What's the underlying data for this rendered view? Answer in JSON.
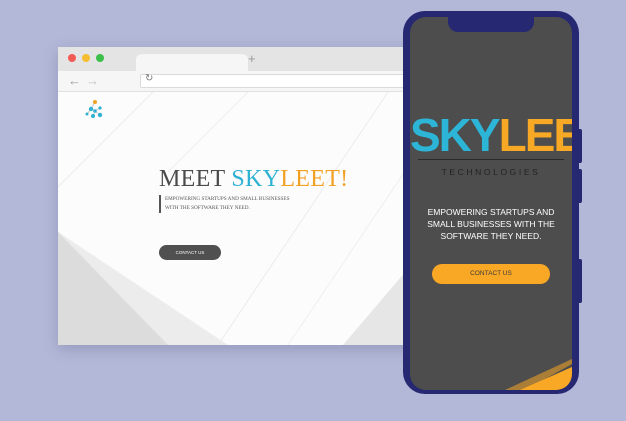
{
  "browser": {
    "new_tab_symbol": "+",
    "back_icon": "←",
    "forward_icon": "→",
    "reload_icon": "↻"
  },
  "desktop": {
    "logo_icon": "skyleet-molecule-logo",
    "title_prefix": "MEET ",
    "title_sky": "SKY",
    "title_leet": "LEET!",
    "tagline": "EMPOWERING STARTUPS AND SMALL BUSINESSES WITH THE SOFTWARE THEY NEED.",
    "cta_label": "CONTACT US"
  },
  "phone": {
    "brand_sky": "SKY",
    "brand_leet": "LEET",
    "brand_sub": "TECHNOLOGIES",
    "tagline": "EMPOWERING STARTUPS AND SMALL BUSINESSES WITH THE SOFTWARE THEY NEED.",
    "cta_label": "CONTACT US"
  },
  "colors": {
    "background": "#b3b8d9",
    "brand_blue": "#2cb5d6",
    "brand_orange": "#f7a824",
    "phone_frame": "#262872",
    "phone_screen": "#4d4d4d"
  }
}
